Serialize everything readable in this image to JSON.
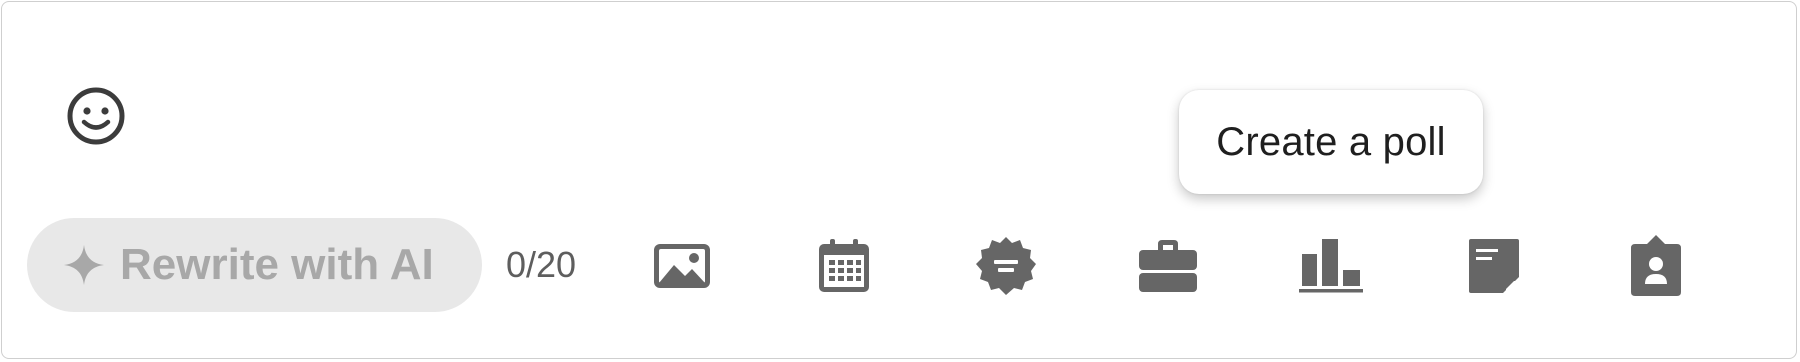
{
  "composer": {
    "ai_rewrite_label": "Rewrite with AI",
    "char_counter": "0/20"
  },
  "tooltip": {
    "text": "Create a poll"
  },
  "icons": {
    "emoji": "smiley-face-icon",
    "sparkle": "sparkle-icon",
    "toolbar": [
      "image-icon",
      "calendar-icon",
      "badge-icon",
      "briefcase-icon",
      "bar-chart-icon",
      "sticky-note-icon",
      "id-badge-icon"
    ]
  },
  "colors": {
    "icon": "#666666",
    "ai_button_bg": "#e8e8e8",
    "ai_button_text": "#a8a8a8",
    "tooltip_bg": "#ffffff"
  }
}
